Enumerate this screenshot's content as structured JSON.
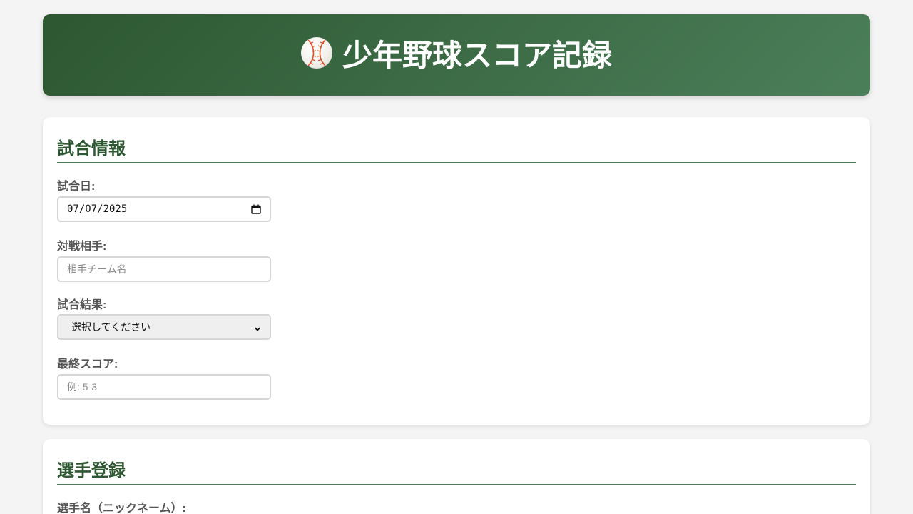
{
  "header": {
    "title": "少年野球スコア記録",
    "icon": "baseball-icon"
  },
  "game_info": {
    "section_title": "試合情報",
    "date_label": "試合日:",
    "date_value": "07/07/2025",
    "opponent_label": "対戦相手:",
    "opponent_placeholder": "相手チーム名",
    "result_label": "試合結果:",
    "result_selected": "選択してください",
    "score_label": "最終スコア:",
    "score_placeholder": "例: 5-3"
  },
  "player_registration": {
    "section_title": "選手登録",
    "name_label": "選手名（ニックネーム）:"
  },
  "colors": {
    "brand_dark": "#2d5730",
    "brand_light": "#4b7f5a",
    "background": "#f4f4f4"
  }
}
